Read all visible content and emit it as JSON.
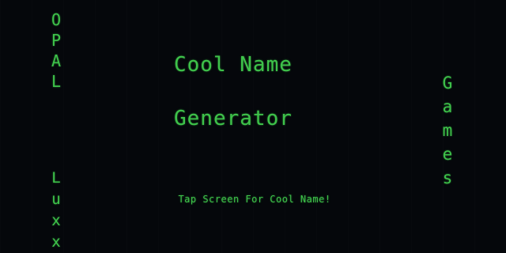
{
  "left_brand": {
    "top_letters": [
      "O",
      "P",
      "A",
      "L"
    ],
    "bottom_letters": [
      "L",
      "u",
      "x",
      "x"
    ]
  },
  "right_brand": {
    "letters": [
      "G",
      "a",
      "m",
      "e",
      "s"
    ]
  },
  "title": {
    "line1": "Cool Name",
    "line2": "Generator"
  },
  "prompt": {
    "text": "Tap Screen For Cool Name!"
  },
  "colors": {
    "background": "#05070b",
    "text": "#3ec24a"
  }
}
